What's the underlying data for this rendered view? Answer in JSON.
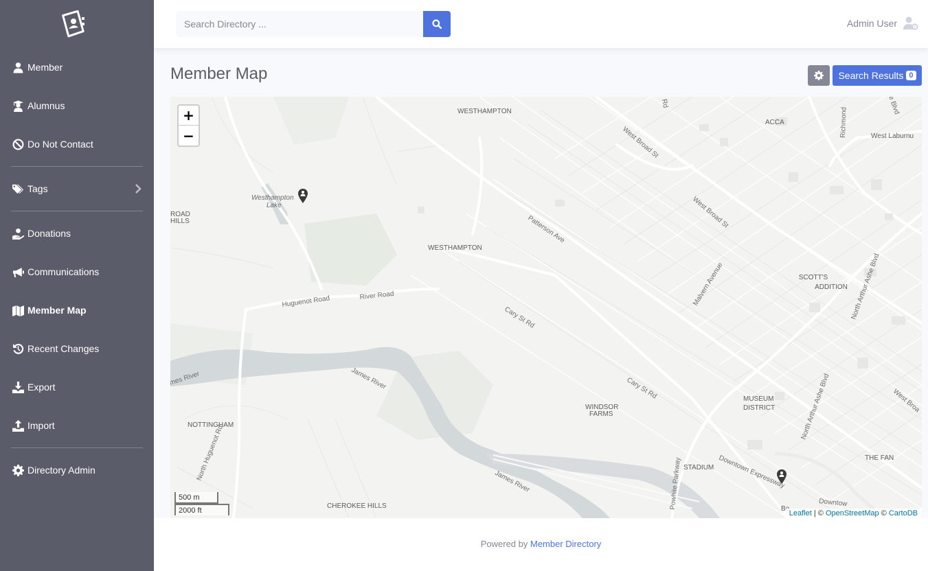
{
  "sidebar": {
    "items": [
      {
        "label": "Member",
        "icon": "user-icon"
      },
      {
        "label": "Alumnus",
        "icon": "graduate-icon"
      },
      {
        "label": "Do Not Contact",
        "icon": "ban-icon"
      },
      {
        "label": "Tags",
        "icon": "tags-icon"
      },
      {
        "label": "Donations",
        "icon": "donate-icon"
      },
      {
        "label": "Communications",
        "icon": "bullhorn-icon"
      },
      {
        "label": "Member Map",
        "icon": "map-icon"
      },
      {
        "label": "Recent Changes",
        "icon": "history-icon"
      },
      {
        "label": "Export",
        "icon": "download-icon"
      },
      {
        "label": "Import",
        "icon": "upload-icon"
      },
      {
        "label": "Directory Admin",
        "icon": "cog-icon"
      }
    ],
    "active": "Member Map"
  },
  "topbar": {
    "search_placeholder": "Search Directory ...",
    "user_name": "Admin User"
  },
  "page": {
    "title": "Member Map",
    "results_label": "Search Results",
    "results_count": "0"
  },
  "map": {
    "zoom_in": "+",
    "zoom_out": "−",
    "scale_metric": "500 m",
    "scale_imperial": "2000 ft",
    "attribution": {
      "leaflet": "Leaflet",
      "sep1": " | © ",
      "osm": "OpenStreetMap",
      "sep2": " © ",
      "carto": "CartoDB"
    },
    "labels": {
      "westhampton_top": "WESTHAMPTON",
      "westhampton_mid": "WESTHAMPTON",
      "lake_1": "Westhampton",
      "lake_2": "Lake",
      "acca": "ACCA",
      "richmond": "Richmond",
      "west_laburnum": "West Laburnu",
      "west_broad_1": "West Broad St",
      "west_broad_2": "West Broad St",
      "west_broad_3": "West Broa",
      "patterson": "Patterson Ave",
      "malvern": "Malvern Avenue",
      "scotts_1": "SCOTT'S",
      "scotts_2": "ADDITION",
      "arthur_ashe_1": "North Arthur Ashe Blvd",
      "arthur_ashe_2": "North Arthur Ashe Blvd",
      "huguenot_road": "Huguenot Road",
      "river_road": "River Road",
      "cary_1": "Cary St Rd",
      "cary_2": "Cary St Rd",
      "james_1": "James River",
      "james_2": "James River",
      "james_3": "mes River",
      "windsor_1": "WINDSOR",
      "windsor_2": "FARMS",
      "museum_1": "MUSEUM",
      "museum_2": "DISTRICT",
      "the_fan": "THE FAN",
      "stadium": "STADIUM",
      "downtown_exp": "Downtown Expressway",
      "downtown_2": "Downtow",
      "nottingham": "NOTTINGHAM",
      "north_huguenot": "North Huguenot Rd",
      "cherokee": "CHEROKEE HILLS",
      "powhite": "Powhite Parkway",
      "road_hills_1": "ROAD",
      "road_hills_2": "HILLS",
      "rd_top": "Rd",
      "blvd_top": "e Blvd",
      "bo": "Bo"
    },
    "markers": 2
  },
  "footer": {
    "prefix": "Powered by ",
    "link": "Member Directory"
  },
  "colors": {
    "sidebar": "#5a5c69",
    "primary": "#4e73df",
    "secondary": "#858796",
    "water": "#d4dadc",
    "park": "#e3e8e1"
  }
}
